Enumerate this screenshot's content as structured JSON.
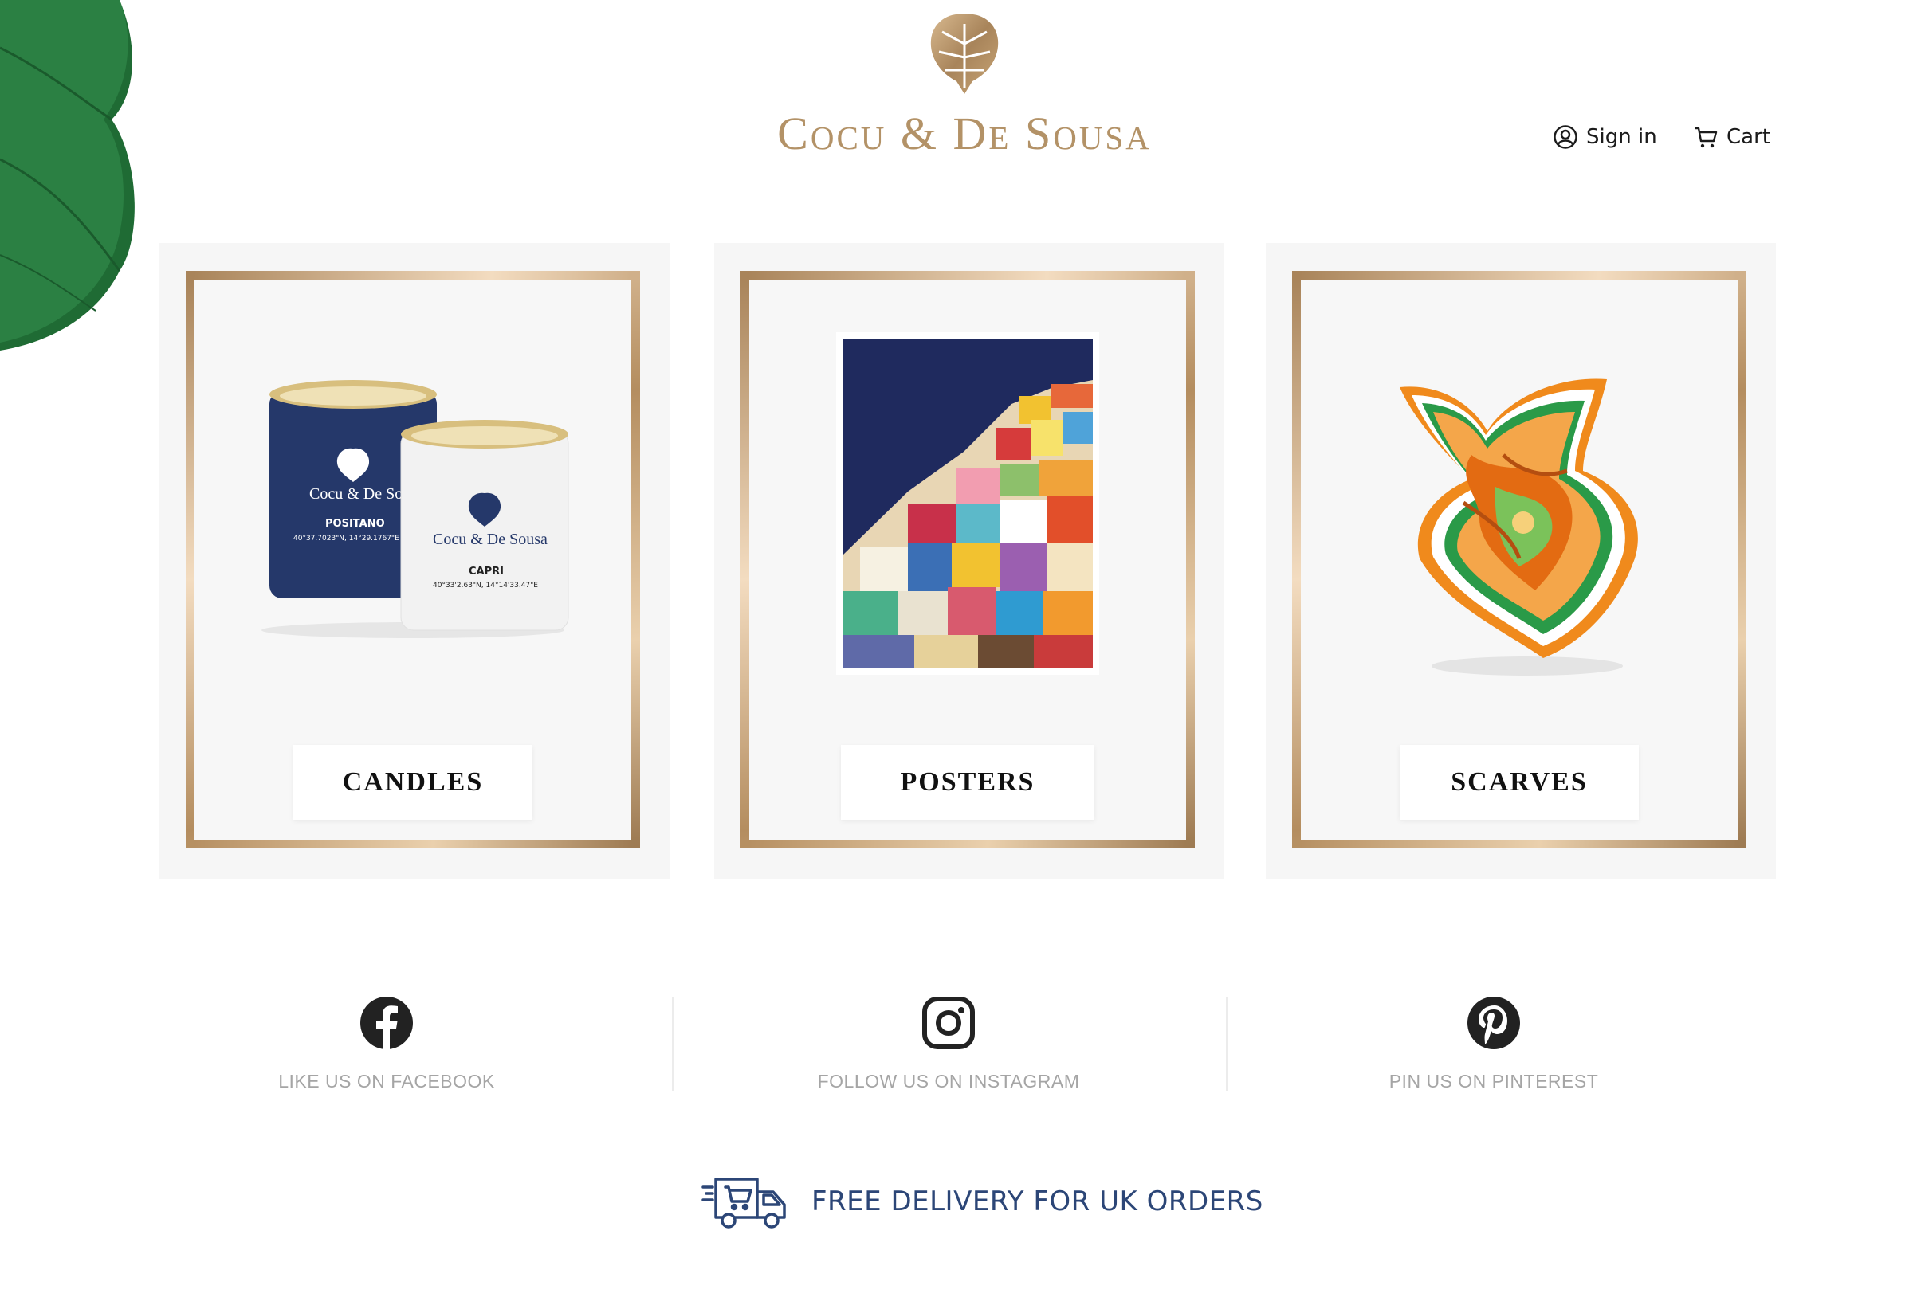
{
  "header": {
    "brand": "Cocu & De Sousa",
    "sign_in_label": "Sign in",
    "cart_label": "Cart"
  },
  "categories": [
    {
      "label": "CANDLES",
      "image": "candles-image"
    },
    {
      "label": "POSTERS",
      "image": "poster-image"
    },
    {
      "label": "SCARVES",
      "image": "scarf-image"
    }
  ],
  "product_text": {
    "candle_1_brand": "Cocu & De Sousa",
    "candle_1_name": "POSITANO",
    "candle_1_coords": "40°37.7023\"N, 14°29.1767\"E",
    "candle_2_brand": "Cocu & De Sousa",
    "candle_2_name": "CAPRI",
    "candle_2_coords": "40°33'2.63\"N, 14°14'33.47\"E"
  },
  "social": {
    "facebook": "LIKE US ON FACEBOOK",
    "instagram": "FOLLOW US ON INSTAGRAM",
    "pinterest": "PIN US ON PINTEREST"
  },
  "delivery": {
    "text": "FREE DELIVERY FOR UK ORDERS"
  },
  "colors": {
    "gold": "#b39267",
    "navy": "#2c4677",
    "card_bg": "#f6f6f6",
    "muted_text": "#a5a5a5"
  },
  "icons": [
    "leaf-decoration",
    "logo-leaf-icon",
    "user-icon",
    "cart-icon",
    "facebook-icon",
    "instagram-icon",
    "pinterest-icon",
    "delivery-truck-icon"
  ]
}
